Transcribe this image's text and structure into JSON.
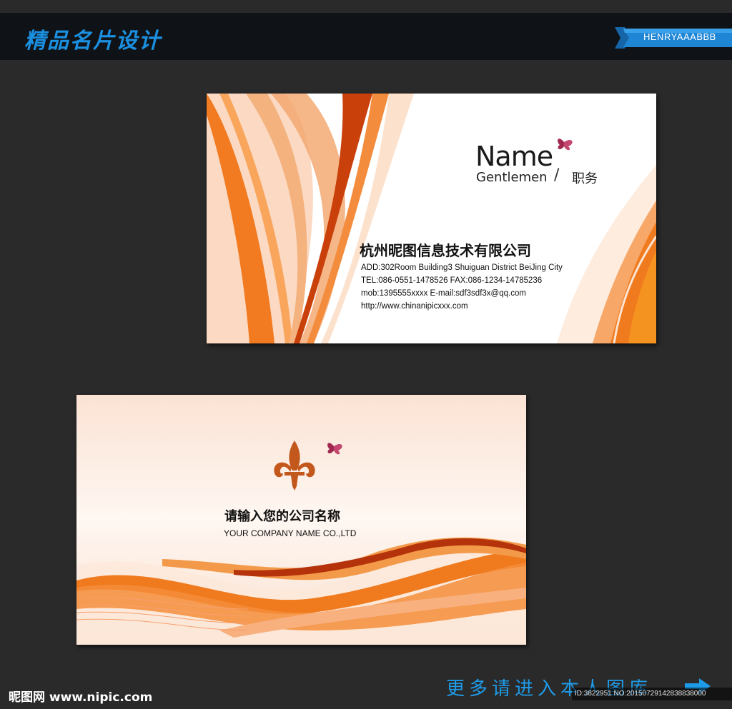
{
  "header": {
    "title": "精品名片设计",
    "ribbon_text": "HENRYAAABBB"
  },
  "card_front": {
    "name": "Name",
    "subtitle": "Gentlemen",
    "slash": "/",
    "position": "职务",
    "company": "杭州昵图信息技术有限公司",
    "address": "ADD:302Room Building3 Shuiguan  District BeiJing City",
    "phone": "TEL:086-0551-1478526   FAX:086-1234-14785236",
    "mobile": "mob:1395555xxxx  E-mail:sdf3sdf3x@qq.com",
    "website": "http://www.chinanipicxxx.com"
  },
  "card_back": {
    "company_cn": "请输入您的公司名称",
    "company_en": "YOUR COMPANY NAME CO.,LTD"
  },
  "footer": {
    "site": "昵图网 www.nipic.com",
    "more_text": "更多请进入本人图库",
    "id_text": "ID:3822951 NO:20150729142838838000"
  },
  "colors": {
    "accent": "#1b8fe0",
    "orange": "#f07a1e",
    "dark_orange": "#c9400a",
    "butterfly": "#a0284e"
  }
}
